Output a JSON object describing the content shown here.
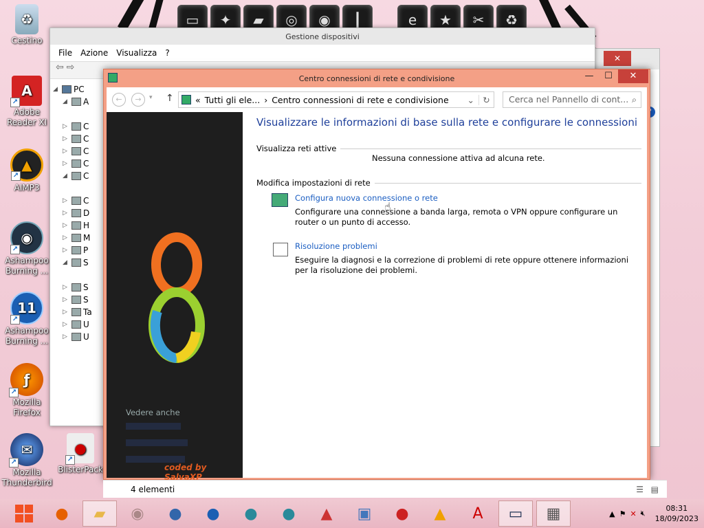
{
  "desktop": {
    "icons": [
      {
        "label": "Cestino",
        "icon": "recycle-bin-icon"
      },
      {
        "label": "Adobe Reader XI",
        "icon": "pdf-icon"
      },
      {
        "label": "AIMP3",
        "icon": "aimp-icon"
      },
      {
        "label": "Ashampoo Burning ...",
        "icon": "disc-icon"
      },
      {
        "label": "Ashampoo Burning ...",
        "icon": "disc11-icon"
      },
      {
        "label": "Mozilla Firefox",
        "icon": "firefox-icon"
      },
      {
        "label": "Mozilla Thunderbird",
        "icon": "thunderbird-icon"
      },
      {
        "label": "BlisterPack",
        "icon": "blisterpack-icon"
      }
    ]
  },
  "devmgr": {
    "title": "Gestione dispositivi",
    "menu": [
      "File",
      "Azione",
      "Visualizza",
      "?"
    ],
    "tree": {
      "root": "PC",
      "items": [
        "A",
        "C",
        "C",
        "C",
        "C",
        "C",
        "C",
        "D",
        "H",
        "M",
        "P",
        "S",
        "S",
        "S",
        "Ta",
        "U",
        "U"
      ]
    }
  },
  "window": {
    "title": "Centro connessioni di rete e condivisione",
    "address": {
      "prefix": "«",
      "crumb1": "Tutti gli ele...",
      "sep": "›",
      "crumb2": "Centro connessioni di rete e condivisione"
    },
    "search_placeholder": "Cerca nel Pannello di cont...",
    "heading": "Visualizzare le informazioni di base sulla rete e configurare le connessioni",
    "active_section": "Visualizza reti attive",
    "no_connection": "Nessuna connessione attiva ad alcuna rete.",
    "modify_section": "Modifica impostazioni di rete",
    "tasks": [
      {
        "link": "Configura nuova connessione o rete",
        "desc": "Configurare una connessione a banda larga, remota o VPN oppure configurare un router o un punto di accesso."
      },
      {
        "link": "Risoluzione problemi",
        "desc": "Eseguire la diagnosi e la correzione di problemi di rete oppure ottenere informazioni per la risoluzione dei problemi."
      }
    ],
    "sidebar": {
      "see_also": "Vedere anche",
      "credit": "coded by SalvaXP",
      "logo": "8"
    },
    "status": "4 elementi"
  },
  "taskbar": {
    "time": "08:31",
    "date": "18/09/2023"
  }
}
